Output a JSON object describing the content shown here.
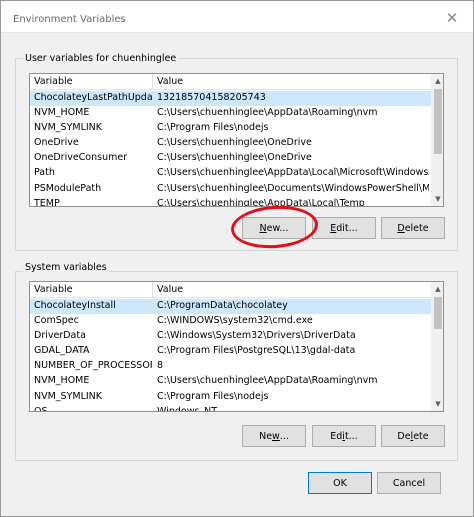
{
  "window": {
    "title": "Environment Variables",
    "close_glyph": "✕"
  },
  "user_section": {
    "label": "User variables for chuenhinglee",
    "columns": [
      "Variable",
      "Value"
    ],
    "rows": [
      {
        "variable": "ChocolateyLastPathUpdate",
        "value": "132185704158205743",
        "selected": true
      },
      {
        "variable": "NVM_HOME",
        "value": "C:\\Users\\chuenhinglee\\AppData\\Roaming\\nvm"
      },
      {
        "variable": "NVM_SYMLINK",
        "value": "C:\\Program Files\\nodejs"
      },
      {
        "variable": "OneDrive",
        "value": "C:\\Users\\chuenhinglee\\OneDrive"
      },
      {
        "variable": "OneDriveConsumer",
        "value": "C:\\Users\\chuenhinglee\\OneDrive"
      },
      {
        "variable": "Path",
        "value": "C:\\Users\\chuenhinglee\\AppData\\Local\\Microsoft\\WindowsApps;..."
      },
      {
        "variable": "PSModulePath",
        "value": "C:\\Users\\chuenhinglee\\Documents\\WindowsPowerShell\\Module..."
      },
      {
        "variable": "TEMP",
        "value": "C:\\Users\\chuenhinglee\\AppData\\Local\\Temp"
      }
    ],
    "buttons": {
      "new": {
        "mnemonic": "N",
        "rest": "ew..."
      },
      "edit": {
        "mnemonic": "E",
        "rest": "dit..."
      },
      "delete": {
        "mnemonic": "D",
        "rest": "elete"
      }
    }
  },
  "system_section": {
    "label": "System variables",
    "columns": [
      "Variable",
      "Value"
    ],
    "rows": [
      {
        "variable": "ChocolateyInstall",
        "value": "C:\\ProgramData\\chocolatey",
        "selected": true
      },
      {
        "variable": "ComSpec",
        "value": "C:\\WINDOWS\\system32\\cmd.exe"
      },
      {
        "variable": "DriverData",
        "value": "C:\\Windows\\System32\\Drivers\\DriverData"
      },
      {
        "variable": "GDAL_DATA",
        "value": "C:\\Program Files\\PostgreSQL\\13\\gdal-data"
      },
      {
        "variable": "NUMBER_OF_PROCESSORS",
        "value": "8"
      },
      {
        "variable": "NVM_HOME",
        "value": "C:\\Users\\chuenhinglee\\AppData\\Roaming\\nvm"
      },
      {
        "variable": "NVM_SYMLINK",
        "value": "C:\\Program Files\\nodejs"
      },
      {
        "variable": "OS",
        "value": "Windows_NT"
      }
    ],
    "buttons": {
      "new": {
        "before": "Ne",
        "mnemonic": "w",
        "rest": "..."
      },
      "edit": {
        "before": "Ed",
        "mnemonic": "i",
        "rest": "t..."
      },
      "delete": {
        "before": "De",
        "mnemonic": "l",
        "rest": "ete"
      }
    }
  },
  "dialog_buttons": {
    "ok": "OK",
    "cancel": "Cancel"
  },
  "colors": {
    "annotation_circle": "#e0101a",
    "selection": "#cce8ff"
  }
}
